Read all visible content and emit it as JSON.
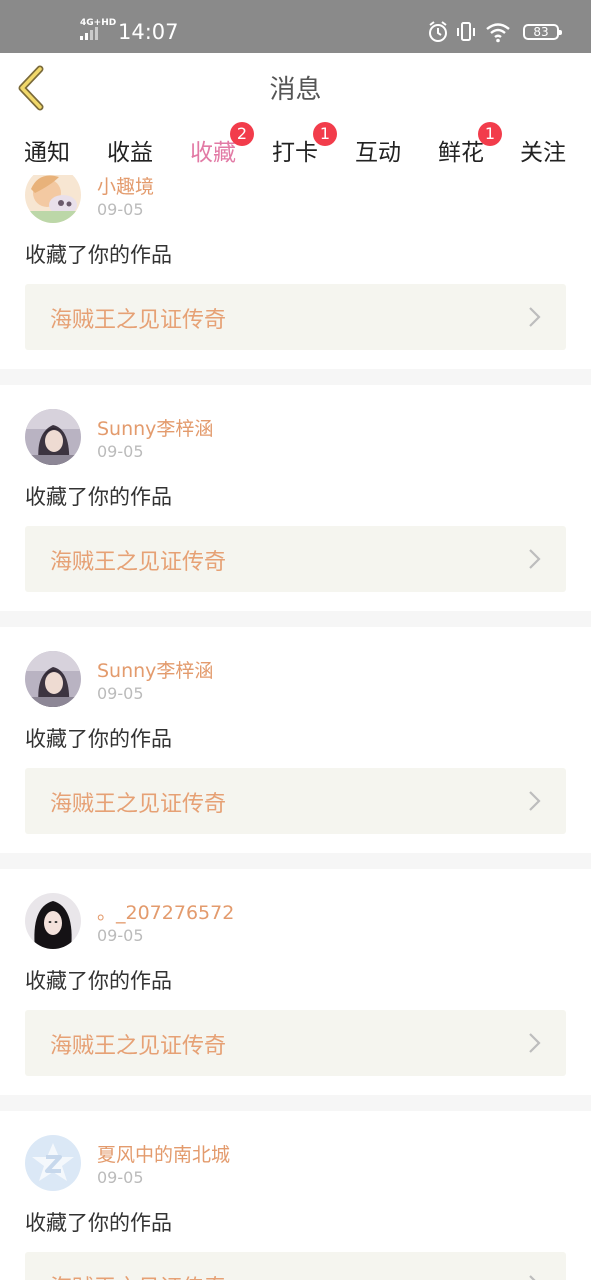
{
  "status_bar": {
    "network": "4G+HD",
    "time": "14:07",
    "battery": "83"
  },
  "header": {
    "title": "消息"
  },
  "tabs": [
    {
      "label": "通知",
      "badge": null
    },
    {
      "label": "收益",
      "badge": null
    },
    {
      "label": "收藏",
      "badge": "2",
      "active": true
    },
    {
      "label": "打卡",
      "badge": "1"
    },
    {
      "label": "互动",
      "badge": null
    },
    {
      "label": "鲜花",
      "badge": "1"
    },
    {
      "label": "关注",
      "badge": null
    }
  ],
  "feed": [
    {
      "user": "小趣境",
      "date": "09-05",
      "action": "收藏了你的作品",
      "work": "海贼王之见证传奇",
      "avatar": "avatar-anime"
    },
    {
      "user": "Sunny李梓涵",
      "date": "09-05",
      "action": "收藏了你的作品",
      "work": "海贼王之见证传奇",
      "avatar": "avatar-photo-girl"
    },
    {
      "user": "Sunny李梓涵",
      "date": "09-05",
      "action": "收藏了你的作品",
      "work": "海贼王之见证传奇",
      "avatar": "avatar-photo-girl"
    },
    {
      "user": "。_207276572",
      "date": "09-05",
      "action": "收藏了你的作品",
      "work": "海贼王之见证传奇",
      "avatar": "avatar-photo-dark-hair"
    },
    {
      "user": "夏风中的南北城",
      "date": "09-05",
      "action": "收藏了你的作品",
      "work": "海贼王之见证传奇",
      "avatar": "avatar-default-z"
    }
  ],
  "colors": {
    "accent": "#e27aa5",
    "badge": "#f23c4b",
    "username": "#e39b6d",
    "work_title": "#e6a175",
    "work_bg": "#f5f5ef"
  }
}
